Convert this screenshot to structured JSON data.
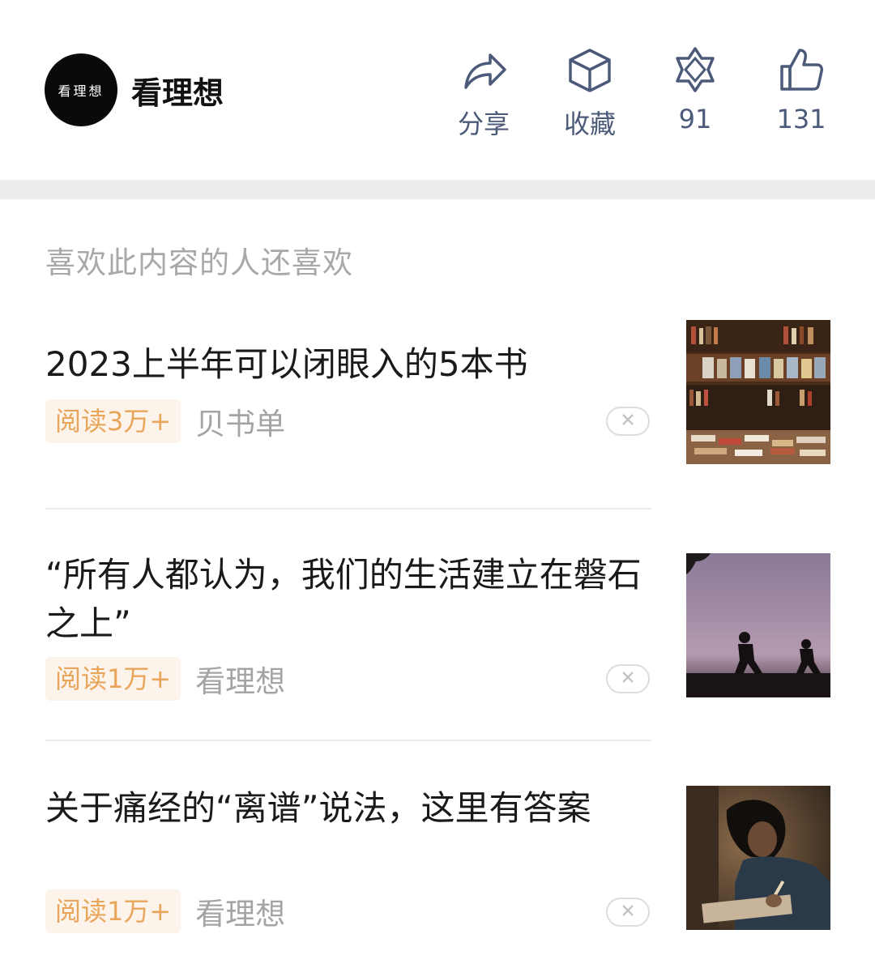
{
  "header": {
    "logo_text": "看理想",
    "account_name": "看理想",
    "actions": [
      {
        "label": "分享",
        "icon": "share-icon"
      },
      {
        "label": "收藏",
        "icon": "collect-box-icon"
      },
      {
        "label": "91",
        "icon": "flower-icon"
      },
      {
        "label": "131",
        "icon": "thumbs-up-icon"
      }
    ]
  },
  "recommend": {
    "section_title": "喜欢此内容的人还喜欢",
    "items": [
      {
        "title": "2023上半年可以闭眼入的5本书",
        "reads": "阅读3万+",
        "source": "贝书单",
        "thumb": "bookstore-photo"
      },
      {
        "title": "“所有人都认为，我们的生活建立在磐石之上”",
        "reads": "阅读1万+",
        "source": "看理想",
        "thumb": "silhouette-runners-photo"
      },
      {
        "title": "关于痛经的“离谱”说法，这里有答案",
        "reads": "阅读1万+",
        "source": "看理想",
        "thumb": "person-writing-photo"
      }
    ]
  },
  "colors": {
    "action_color": "#4c5a7a",
    "badge_bg": "#fcf3ea",
    "badge_text": "#e9a65b",
    "muted_text": "#a4a4a4"
  }
}
